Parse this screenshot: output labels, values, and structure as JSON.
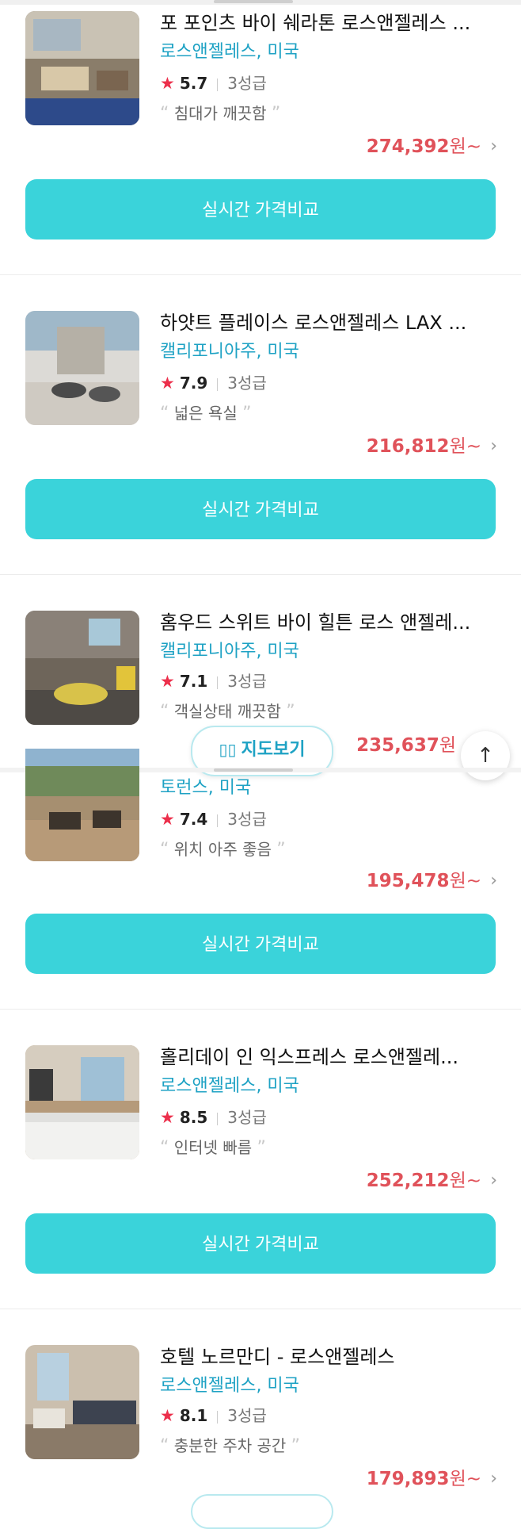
{
  "hotels": [
    {
      "name": "포 포인츠 바이 쉐라톤 로스앤젤레스 ...",
      "location": "로스앤젤레스, 미국",
      "score": "5.7",
      "grade": "3성급",
      "review": "침대가 깨끗함",
      "price": "274,392",
      "price_suffix": "원~"
    },
    {
      "name": "하얏트 플레이스 로스앤젤레스 LAX ...",
      "location": "캘리포니아주, 미국",
      "score": "7.9",
      "grade": "3성급",
      "review": "넓은 욕실",
      "price": "216,812",
      "price_suffix": "원~"
    },
    {
      "name": "홈우드 스위트 바이 힐튼 로스 앤젤레...",
      "location": "캘리포니아주, 미국",
      "score": "7.1",
      "grade": "3성급",
      "review": "객실상태 깨끗함",
      "price": "235,637",
      "price_suffix": "원"
    },
    {
      "name": "",
      "location": "토런스, 미국",
      "score": "7.4",
      "grade": "3성급",
      "review": "위치 아주 좋음",
      "price": "195,478",
      "price_suffix": "원~"
    },
    {
      "name": "홀리데이 인 익스프레스 로스앤젤레...",
      "location": "로스앤젤레스, 미국",
      "score": "8.5",
      "grade": "3성급",
      "review": "인터넷 빠름",
      "price": "252,212",
      "price_suffix": "원~"
    },
    {
      "name": "호텔 노르만디 - 로스앤젤레스",
      "location": "로스앤젤레스, 미국",
      "score": "8.1",
      "grade": "3성급",
      "review": "충분한 주차 공간",
      "price": "179,893",
      "price_suffix": "원~"
    }
  ],
  "cta_label": "실시간 가격비교",
  "map_button": {
    "label": "지도보기",
    "icon": "map-icon"
  },
  "scroll_top": {
    "icon": "arrow-up-icon"
  },
  "icons": {
    "star": "star-icon",
    "chevron": "chevron-right-icon",
    "quote_open": "quote-open-icon",
    "quote_close": "quote-close-icon"
  },
  "colors": {
    "accent": "#3ad3da",
    "location": "#1ea2c4",
    "price": "#e0525a",
    "star": "#ec2f4b"
  }
}
